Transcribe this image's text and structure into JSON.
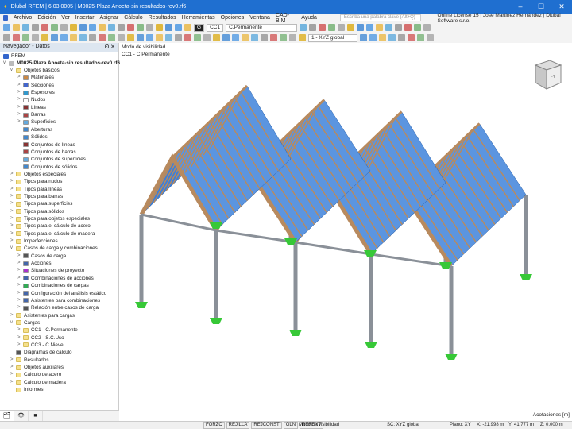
{
  "title": "Dlubal RFEM | 6.03.0005 | M0025-Plaza Anoeta-sin resultados-rev0.rf6",
  "menu": [
    "Archivo",
    "Edición",
    "Ver",
    "Insertar",
    "Asignar",
    "Cálculo",
    "Resultados",
    "Herramientas",
    "Opciones",
    "Ventana",
    "CAD-BIM",
    "Ayuda"
  ],
  "search_placeholder": "Escriba una palabra clave (Alt+Q)",
  "license": "Online License 15 | Jose Martinez Hernández | Dlubal Software s.r.o.",
  "toolbar": {
    "lc_badge": "G",
    "lc_id": "CC1",
    "lc_name": "C.Permanente",
    "cs": "1 - XYZ global"
  },
  "navigator": {
    "title": "Navegador - Datos",
    "root": "RFEM",
    "model": "M0025-Plaza Anoeta-sin resultados-rev0.rf6",
    "items": [
      {
        "l": "Objetos básicos",
        "d": 1,
        "f": 1,
        "a": "v"
      },
      {
        "l": "Materiales",
        "d": 2,
        "c": "#c84",
        "a": ">"
      },
      {
        "l": "Secciones",
        "d": 2,
        "c": "#46c",
        "a": ">"
      },
      {
        "l": "Espesores",
        "d": 2,
        "c": "#39c",
        "a": ">"
      },
      {
        "l": "Nudos",
        "d": 2,
        "c": "#fff",
        "a": ">"
      },
      {
        "l": "Líneas",
        "d": 2,
        "c": "#833",
        "a": ">"
      },
      {
        "l": "Barras",
        "d": 2,
        "c": "#a44",
        "a": ">"
      },
      {
        "l": "Superficies",
        "d": 2,
        "c": "#6ad",
        "a": ">"
      },
      {
        "l": "Aberturas",
        "d": 2,
        "c": "#48c"
      },
      {
        "l": "Sólidos",
        "d": 2,
        "c": "#48c"
      },
      {
        "l": "Conjuntos de líneas",
        "d": 2,
        "c": "#833"
      },
      {
        "l": "Conjuntos de barras",
        "d": 2,
        "c": "#a44"
      },
      {
        "l": "Conjuntos de superficies",
        "d": 2,
        "c": "#6ad"
      },
      {
        "l": "Conjuntos de sólidos",
        "d": 2,
        "c": "#48c"
      },
      {
        "l": "Objetos especiales",
        "d": 1,
        "f": 1,
        "a": ">"
      },
      {
        "l": "Tipos para nudos",
        "d": 1,
        "f": 1,
        "a": ">"
      },
      {
        "l": "Tipos para líneas",
        "d": 1,
        "f": 1,
        "a": ">"
      },
      {
        "l": "Tipos para barras",
        "d": 1,
        "f": 1,
        "a": ">"
      },
      {
        "l": "Tipos para superficies",
        "d": 1,
        "f": 1,
        "a": ">"
      },
      {
        "l": "Tipos para sólidos",
        "d": 1,
        "f": 1,
        "a": ">"
      },
      {
        "l": "Tipos para objetos especiales",
        "d": 1,
        "f": 1,
        "a": ">"
      },
      {
        "l": "Tipos para el cálculo de acero",
        "d": 1,
        "f": 1,
        "a": ">"
      },
      {
        "l": "Tipos para el cálculo de madera",
        "d": 1,
        "f": 1,
        "a": ">"
      },
      {
        "l": "Imperfecciones",
        "d": 1,
        "f": 1,
        "a": ">"
      },
      {
        "l": "Casos de carga y combinaciones",
        "d": 1,
        "f": 1,
        "a": "v"
      },
      {
        "l": "Casos de carga",
        "d": 2,
        "c": "#555",
        "a": ">"
      },
      {
        "l": "Acciones",
        "d": 2,
        "c": "#46a",
        "a": ">"
      },
      {
        "l": "Situaciones de proyecto",
        "d": 2,
        "c": "#a3c",
        "a": ">"
      },
      {
        "l": "Combinaciones de acciones",
        "d": 2,
        "c": "#46a",
        "a": ">"
      },
      {
        "l": "Combinaciones de cargas",
        "d": 2,
        "c": "#3a5",
        "a": ">"
      },
      {
        "l": "Configuración del análisis estático",
        "d": 2,
        "c": "#46a",
        "a": ">"
      },
      {
        "l": "Asistentes para combinaciones",
        "d": 2,
        "c": "#46a",
        "a": ">"
      },
      {
        "l": "Relación entre casos de carga",
        "d": 2,
        "c": "#555",
        "a": ">"
      },
      {
        "l": "Asistentes para cargas",
        "d": 1,
        "f": 1,
        "a": ">"
      },
      {
        "l": "Cargas",
        "d": 1,
        "f": 1,
        "a": "v"
      },
      {
        "l": "CC1 - C.Permanente",
        "d": 2,
        "f": 1,
        "a": ">"
      },
      {
        "l": "CC2 - S.C.Uso",
        "d": 2,
        "f": 1,
        "a": ">"
      },
      {
        "l": "CC3 - C.Nieve",
        "d": 2,
        "f": 1,
        "a": ">"
      },
      {
        "l": "Diagramas de cálculo",
        "d": 1,
        "c": "#555"
      },
      {
        "l": "Resultados",
        "d": 1,
        "f": 1,
        "a": ">"
      },
      {
        "l": "Objetos auxiliares",
        "d": 1,
        "f": 1,
        "a": ">"
      },
      {
        "l": "Cálculo de acero",
        "d": 1,
        "f": 1,
        "a": ">"
      },
      {
        "l": "Cálculo de madera",
        "d": 1,
        "f": 1,
        "a": ">"
      },
      {
        "l": "Informes",
        "d": 1,
        "f": 1
      }
    ]
  },
  "view": {
    "mode": "Modo de visibilidad",
    "lc": "CC1 - C.Permanente",
    "dims": "Acotaciones [m]",
    "cube_label": "-Y"
  },
  "status": {
    "toggles": [
      "FORZC",
      "REJILLA",
      "REJCONST",
      "GLN",
      "REFENT"
    ],
    "mode": "Modo de visibilidad",
    "cs": "SC: XYZ global",
    "plane": "Plano: XY",
    "x": "X: -21.998 m",
    "y": "Y: 41.777 m",
    "z": "Z: 0.000 m"
  },
  "colors": {
    "titlebar": "#1f6fd0",
    "roof": "#3d7fd9",
    "timber": "#b88a5e",
    "steel": "#8a9098",
    "support": "#37c837"
  }
}
